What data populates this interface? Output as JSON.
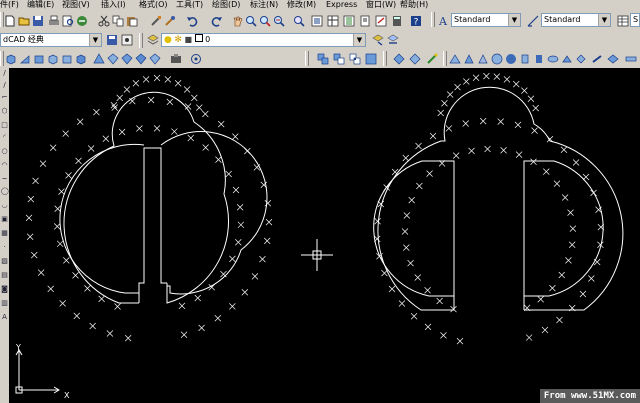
{
  "menu": {
    "items": [
      "编辑(E)",
      "视图(V)",
      "插入(I)",
      "工具(T)",
      "格式(O)",
      "绘图(D)",
      "标注(N)",
      "修改(M)",
      "Express",
      "窗口(W)",
      "帮助(H)"
    ],
    "partial_first": "件(F)"
  },
  "toolbar_standard": {
    "text_style_combo": "Standard",
    "dim_style_combo": "Standard",
    "table_style_combo": "S"
  },
  "toolbar_workspace": {
    "workspace_combo": "dCAD 经典",
    "layer_combo": "0"
  },
  "ucs": {
    "y_label": "Y",
    "x_label": "X"
  },
  "watermark": "From www.51MX.com",
  "colors": {
    "canvas_bg": "#000000",
    "geometry": "#ffffff",
    "chrome": "#d4d0c8",
    "watermark_bg": "#5a5a5a"
  },
  "icons": {
    "toolbar1": [
      "new-icon",
      "open-icon",
      "save-icon",
      "print-icon",
      "preview-icon",
      "publish-icon",
      "cut-icon",
      "copy-icon",
      "paste-icon",
      "match-prop-icon",
      "brush-icon",
      "undo-icon",
      "redo-icon",
      "pan-icon",
      "zoom-realtime-icon",
      "zoom-window-icon",
      "zoom-previous-icon",
      "properties-icon",
      "design-center-icon",
      "tool-palettes-icon",
      "sheet-set-icon",
      "markup-icon",
      "calculator-icon",
      "help-icon"
    ],
    "toolbar2": [
      "workspace-save-icon",
      "workspace-settings-icon",
      "layer-manager-icon",
      "layer-state-icons",
      "layer-previous-icon",
      "make-current-icon"
    ],
    "toolbar3": [
      "box-icon",
      "wedge-icon",
      "cone-icon",
      "sphere-icon",
      "cylinder-icon",
      "torus-icon",
      "pyramid-icon",
      "helix-icon",
      "planar-surface-icon",
      "extrude-icon",
      "presspull-icon",
      "sweep-icon",
      "revolve-icon",
      "loft-icon",
      "union-icon",
      "subtract-icon",
      "intersect-icon",
      "view-top-icon",
      "view-front-icon",
      "view-iso-icon",
      "orbit-icon",
      "render-icon",
      "solid-icons"
    ]
  }
}
